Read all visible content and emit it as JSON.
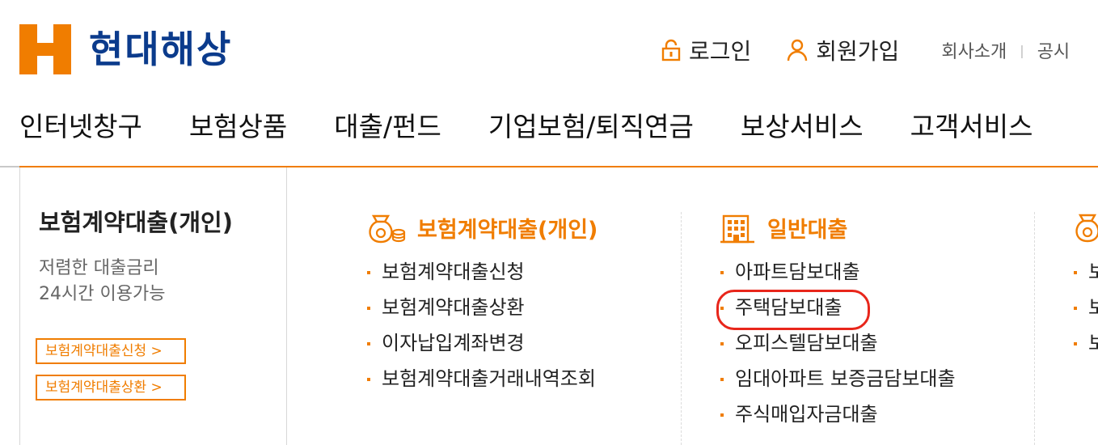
{
  "header": {
    "logo_text": "현대해상",
    "util": {
      "login": "로그인",
      "join": "회원가입",
      "company": "회사소개",
      "separator": "|",
      "notice_partial": "공시"
    }
  },
  "gnb": [
    {
      "label": "인터넷창구"
    },
    {
      "label": "보험상품"
    },
    {
      "label": "대출/펀드"
    },
    {
      "label": "기업보험/퇴직연금"
    },
    {
      "label": "보상서비스"
    },
    {
      "label": "고객서비스"
    }
  ],
  "left_panel": {
    "title": "보험계약대출(개인)",
    "desc_line1": "저렴한 대출금리",
    "desc_line2": "24시간 이용가능",
    "button1": "보험계약대출신청 >",
    "button2": "보험계약대출상환 >"
  },
  "columns": [
    {
      "title": "보험계약대출(개인)",
      "items": [
        "보험계약대출신청",
        "보험계약대출상환",
        "이자납입계좌변경",
        "보험계약대출거래내역조회"
      ]
    },
    {
      "title": "일반대출",
      "items": [
        "아파트담보대출",
        "주택담보대출",
        "오피스텔담보대출",
        "임대아파트 보증금담보대출",
        "주식매입자금대출"
      ]
    },
    {
      "title": "",
      "items": [
        "보",
        "보",
        "보"
      ]
    }
  ],
  "colors": {
    "accent": "#f07d00",
    "brand_blue": "#0b3b8c",
    "highlight_red": "#e8261b"
  }
}
